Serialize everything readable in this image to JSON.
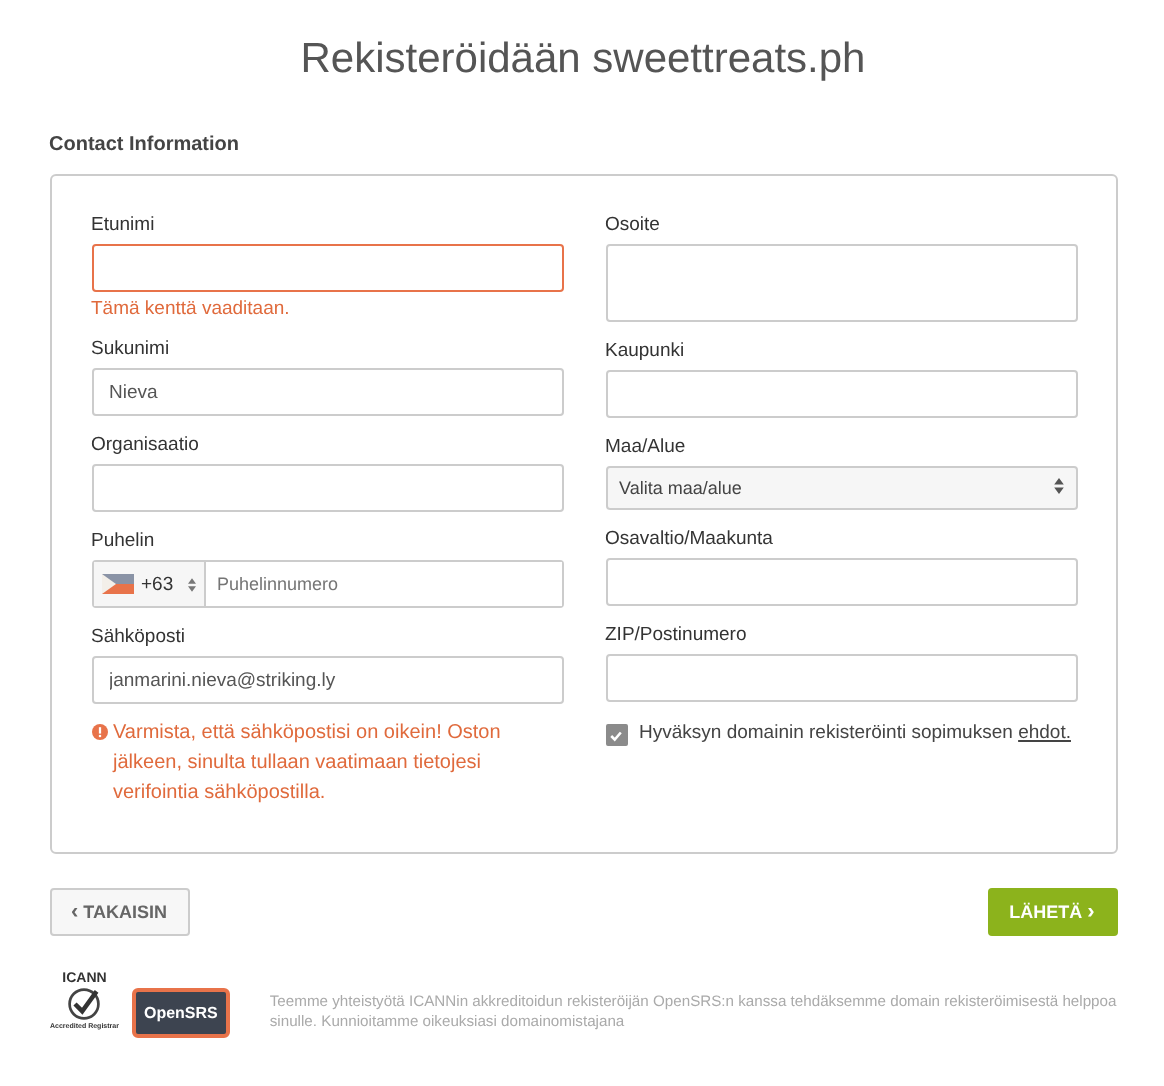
{
  "title": "Rekisteröidään sweettreats.ph",
  "section": "Contact Information",
  "left_fields": [
    {
      "kind": "text",
      "label": "Etunimi",
      "error": true,
      "message": "Tämä kenttä vaaditaan."
    },
    {
      "kind": "text",
      "label": "Sukunimi",
      "value": "Nieva",
      "error": false
    },
    {
      "kind": "text",
      "label": "Organisaatio",
      "error": false
    },
    {
      "kind": "phone",
      "label": "Puhelin",
      "code": "+63",
      "placeholder": "Puhelinnumero",
      "error": false
    },
    {
      "kind": "text",
      "label": "Sähköposti",
      "value": "janmarini.nieva@striking.ly",
      "error": false,
      "warning": "Varmista, että sähköpostisi on oikein! Oston jälkeen, sinulta tullaan vaatimaan tietojesi verifointia sähköpostilla."
    }
  ],
  "right_fields": [
    {
      "kind": "textarea",
      "label": "Osoite"
    },
    {
      "kind": "text",
      "label": "Kaupunki"
    },
    {
      "kind": "select",
      "label": "Maa/Alue",
      "value": "Valita maa/alue"
    },
    {
      "kind": "text",
      "label": "Osavaltio/Maakunta"
    },
    {
      "kind": "text",
      "label": "ZIP/Postinumero"
    },
    {
      "kind": "checkbox",
      "label": "Hyväksyn domainin rekisteröinti sopimuksen",
      "link": "ehdot.",
      "checked": true
    }
  ],
  "buttons": {
    "back": "TAKAISIN",
    "back_icon": "‹",
    "submit": "LÄHETÄ",
    "submit_icon": "›"
  },
  "footer": {
    "icann": "ICANN",
    "icann_sub": "Accredited Registrar",
    "opensrs": "OpenSRS",
    "text": "Teemme yhteistyötä ICANNin akkreditoidun rekisteröijän OpenSRS:n kanssa tehdäksemme domain rekisteröimisestä helppoa sinulle. Kunnioitamme oikeuksiasi domainomistajana"
  }
}
